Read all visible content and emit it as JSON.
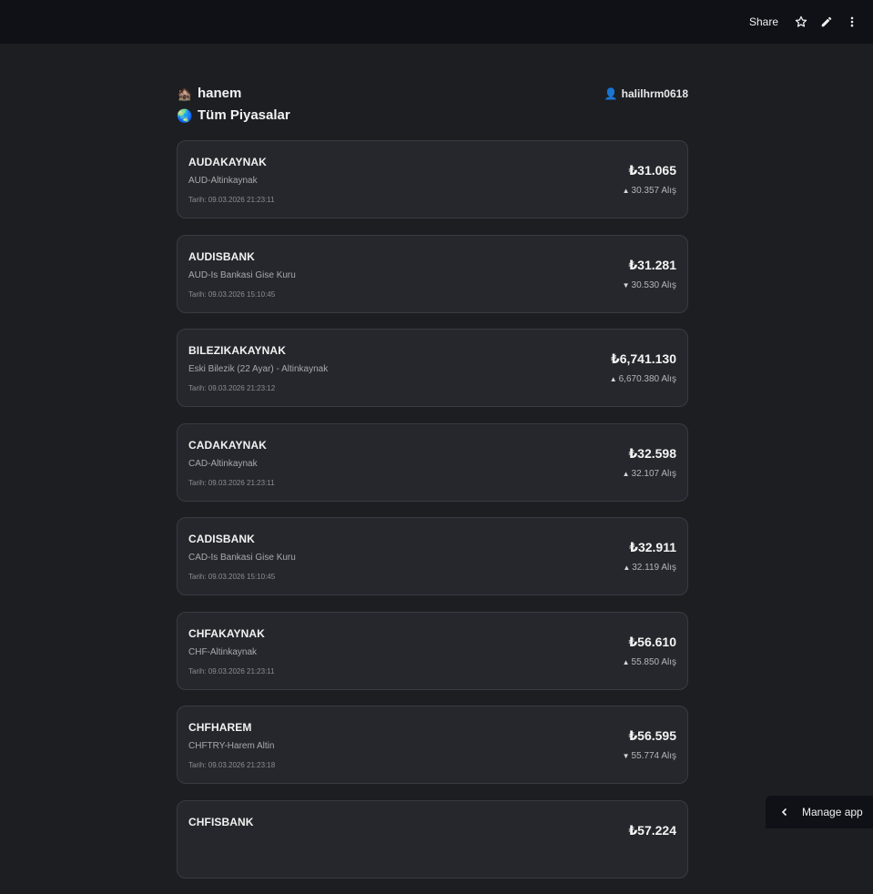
{
  "topbar": {
    "share_label": "Share",
    "icons": [
      "star-icon",
      "pencil-icon",
      "more-vertical-icon"
    ]
  },
  "header": {
    "app_emoji": "🏚️",
    "app_name": "hanem",
    "page_emoji": "🌏",
    "page_title": "Tüm Piyasalar",
    "user_emoji": "👤",
    "username": "halilhrm0618"
  },
  "cards": [
    {
      "code": "AUDAKAYNAK",
      "desc": "AUD-Altinkaynak",
      "date": "Tarih: 09.03.2026 21:23:11",
      "price": "₺31.065",
      "trend": "up",
      "buy": "30.357 Alış"
    },
    {
      "code": "AUDISBANK",
      "desc": "AUD-Is Bankasi Gise Kuru",
      "date": "Tarih: 09.03.2026 15:10:45",
      "price": "₺31.281",
      "trend": "down",
      "buy": "30.530 Alış"
    },
    {
      "code": "BILEZIKAKAYNAK",
      "desc": "Eski Bilezik (22 Ayar) - Altinkaynak",
      "date": "Tarih: 09.03.2026 21:23:12",
      "price": "₺6,741.130",
      "trend": "up",
      "buy": "6,670.380 Alış"
    },
    {
      "code": "CADAKAYNAK",
      "desc": "CAD-Altinkaynak",
      "date": "Tarih: 09.03.2026 21:23:11",
      "price": "₺32.598",
      "trend": "up",
      "buy": "32.107 Alış"
    },
    {
      "code": "CADISBANK",
      "desc": "CAD-Is Bankasi Gise Kuru",
      "date": "Tarih: 09.03.2026 15:10:45",
      "price": "₺32.911",
      "trend": "up",
      "buy": "32.119 Alış"
    },
    {
      "code": "CHFAKAYNAK",
      "desc": "CHF-Altinkaynak",
      "date": "Tarih: 09.03.2026 21:23:11",
      "price": "₺56.610",
      "trend": "up",
      "buy": "55.850 Alış"
    },
    {
      "code": "CHFHAREM",
      "desc": "CHFTRY-Harem Altin",
      "date": "Tarih: 09.03.2026 21:23:18",
      "price": "₺56.595",
      "trend": "down",
      "buy": "55.774 Alış"
    },
    {
      "code": "CHFISBANK",
      "desc": "",
      "date": "",
      "price": "₺57.224",
      "trend": "",
      "buy": ""
    }
  ],
  "manage_app": {
    "label": "Manage app"
  },
  "colors": {
    "background": "#1d1e22",
    "card": "#26272c",
    "topbar": "#0f1117",
    "border": "#3a3b42"
  }
}
